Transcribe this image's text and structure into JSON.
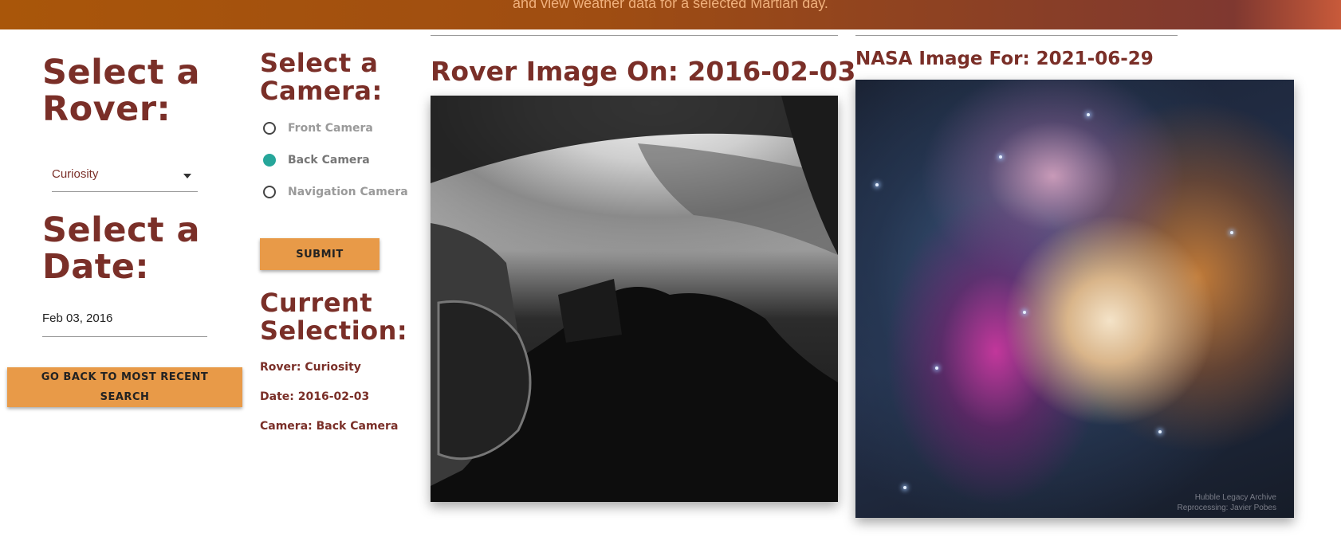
{
  "header": {
    "subtitle": "and view weather data for a selected Martian day."
  },
  "rover_section": {
    "heading_line1": "Select a",
    "heading_line2": "Rover:",
    "selected_rover": "Curiosity"
  },
  "date_section": {
    "heading_line1": "Select a",
    "heading_line2": "Date:",
    "date_value": "Feb 03, 2016"
  },
  "back_button": {
    "line1": "GO BACK TO MOST RECENT",
    "line2": "SEARCH"
  },
  "camera_section": {
    "heading_line1": "Select a",
    "heading_line2": "Camera:",
    "options": [
      {
        "label": "Front Camera",
        "checked": false
      },
      {
        "label": "Back Camera",
        "checked": true
      },
      {
        "label": "Navigation Camera",
        "checked": false
      }
    ],
    "submit_label": "SUBMIT"
  },
  "current_selection": {
    "heading_line1": "Current",
    "heading_line2": "Selection:",
    "rover": "Rover: Curiosity",
    "date": "Date: 2016-02-03",
    "camera": "Camera: Back Camera"
  },
  "rover_image": {
    "title": "Rover Image On: 2016-02-03"
  },
  "nasa_image": {
    "title": "NASA Image For: 2021-06-29",
    "credit_line1": "Hubble Legacy Archive",
    "credit_line2": "Reprocessing: Javier Pobes"
  },
  "colors": {
    "accent_text": "#7a2f28",
    "button": "#e89a48",
    "radio_checked": "#26a69a"
  }
}
